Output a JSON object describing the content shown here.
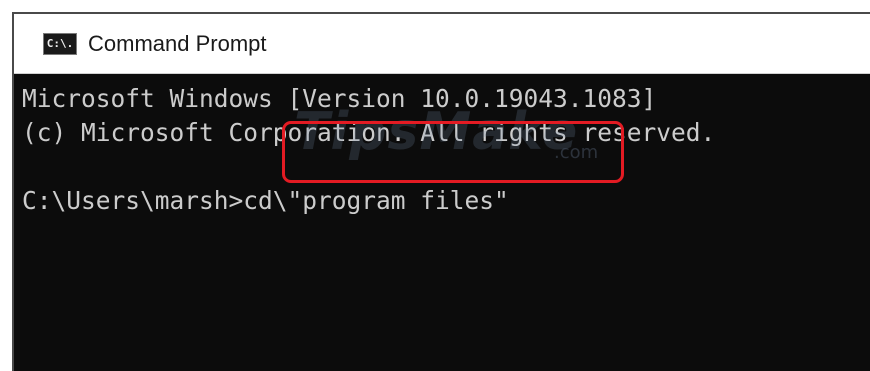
{
  "window": {
    "title": "Command Prompt",
    "icon": "command-prompt-icon",
    "icon_text": "C:\\."
  },
  "console": {
    "lines": [
      "Microsoft Windows [Version 10.0.19043.1083]",
      "(c) Microsoft Corporation. All rights reserved.",
      "C:\\Users\\marsh>cd\\\"program files\""
    ]
  },
  "watermark": {
    "text": "TipsMake",
    "suffix": ".com"
  },
  "colors": {
    "console_background": "#0c0c0c",
    "console_text": "#cccccc",
    "highlight": "#e31b23",
    "titlebar_background": "#ffffff"
  }
}
